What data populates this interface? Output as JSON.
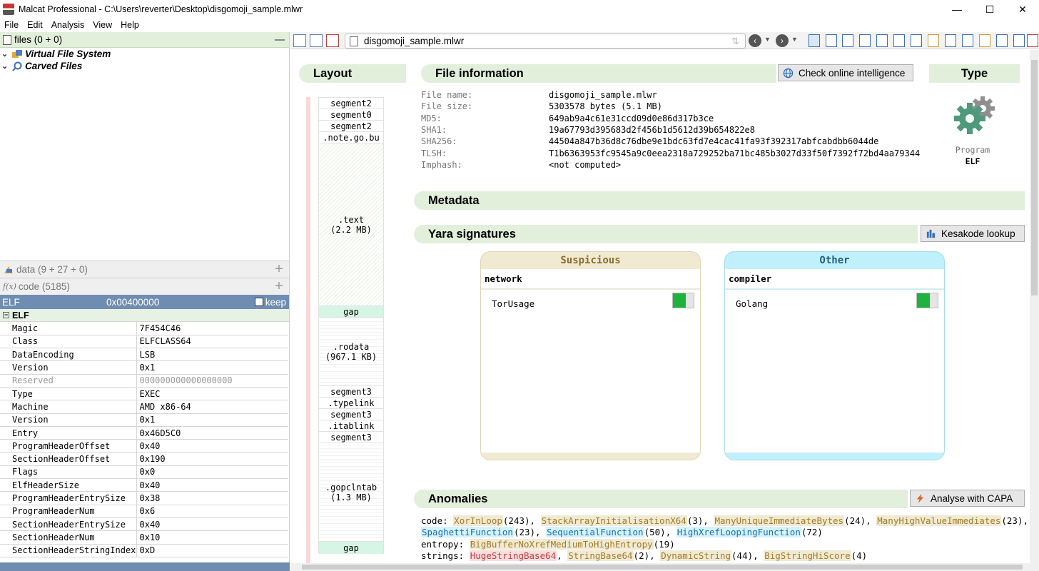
{
  "window": {
    "title": "Malcat Professional - C:\\Users\\reverter\\Desktop\\disgomoji_sample.mlwr",
    "min": "—",
    "max": "☐",
    "close": "✕"
  },
  "menu": [
    "File",
    "Edit",
    "Analysis",
    "View",
    "Help"
  ],
  "files_panel": {
    "header": "files (0 + 0)",
    "items": [
      "Virtual File System",
      "Carved Files"
    ]
  },
  "data_panel": {
    "header": "data (9 + 27 + 0)"
  },
  "code_panel": {
    "header": "code (5185)"
  },
  "structure": {
    "title": "ELF",
    "address": "0x00400000",
    "keep": "keep",
    "group": "ELF",
    "fields": [
      {
        "k": "Magic",
        "v": "7F454C46"
      },
      {
        "k": "Class",
        "v": "ELFCLASS64"
      },
      {
        "k": "DataEncoding",
        "v": "LSB"
      },
      {
        "k": "Version",
        "v": "0x1"
      },
      {
        "k": "Reserved",
        "v": "000000000000000000"
      },
      {
        "k": "Type",
        "v": "EXEC"
      },
      {
        "k": "Machine",
        "v": "AMD x86-64"
      },
      {
        "k": "Version",
        "v": "0x1"
      },
      {
        "k": "Entry",
        "v": "0x46D5C0"
      },
      {
        "k": "ProgramHeaderOffset",
        "v": "0x40"
      },
      {
        "k": "SectionHeaderOffset",
        "v": "0x190"
      },
      {
        "k": "Flags",
        "v": "0x0"
      },
      {
        "k": "ElfHeaderSize",
        "v": "0x40"
      },
      {
        "k": "ProgramHeaderEntrySize",
        "v": "0x38"
      },
      {
        "k": "ProgramHeaderNum",
        "v": "0x6"
      },
      {
        "k": "SectionHeaderEntrySize",
        "v": "0x40"
      },
      {
        "k": "SectionHeaderNum",
        "v": "0x10"
      },
      {
        "k": "SectionHeaderStringIndex",
        "v": "0xD"
      }
    ]
  },
  "toolbar": {
    "path": "disgomoji_sample.mlwr",
    "back": "‹",
    "forward": "›"
  },
  "layout": {
    "title": "Layout",
    "segments": [
      {
        "label": "segment2"
      },
      {
        "label": "segment0"
      },
      {
        "label": "segment2"
      },
      {
        "label": ".note.go.bu"
      },
      {
        "label": ".text",
        "size": "(2.2 MB)"
      },
      {
        "label": "gap"
      },
      {
        "label": ".rodata",
        "size": "(967.1 KB)"
      },
      {
        "label": "segment3"
      },
      {
        "label": ".typelink"
      },
      {
        "label": "segment3"
      },
      {
        "label": ".itablink"
      },
      {
        "label": "segment3"
      },
      {
        "label": ".gopclntab",
        "size": "(1.3 MB)"
      },
      {
        "label": "gap"
      }
    ]
  },
  "file_info": {
    "title": "File information",
    "button": "Check online intelligence",
    "rows": [
      {
        "k": "File name:",
        "v": "disgomoji_sample.mlwr"
      },
      {
        "k": "File size:",
        "v": "5303578 bytes (5.1 MB)"
      },
      {
        "k": "MD5:",
        "v": "649ab9a4c61e31ccd09d0e86d317b3ce"
      },
      {
        "k": "SHA1:",
        "v": "19a67793d395683d2f456b1d5612d39b654822e8"
      },
      {
        "k": "SHA256:",
        "v": "44504a847b36d8c76dbe9e1bdc63fd7e4cac41fa93f392317abfcabdbb6044de"
      },
      {
        "k": "TLSH:",
        "v": "T1b6363953fc9545a9c0eea2318a729252ba71bc485b3027d33f50f7392f72bd4aa79344"
      },
      {
        "k": "Imphash:",
        "v": "<not computed>"
      }
    ]
  },
  "type": {
    "title": "Type",
    "label": "Program",
    "value": "ELF",
    "icon": "gear-icon"
  },
  "metadata": {
    "title": "Metadata"
  },
  "yara": {
    "title": "Yara signatures",
    "button": "Kesakode lookup",
    "cards": [
      {
        "header": "Suspicious",
        "category": "network",
        "rule": "TorUsage",
        "color": "#f1ead2",
        "text_color": "#8a6c2a"
      },
      {
        "header": "Other",
        "category": "compiler",
        "rule": "Golang",
        "color": "#bff0fb",
        "text_color": "#22607c"
      }
    ]
  },
  "anomalies": {
    "title": "Anomalies",
    "button": "Analyse with CAPA",
    "code_label": "code:",
    "code": [
      {
        "t": "XorInLoop",
        "n": "(243)",
        "c": "sand"
      },
      {
        "t": "StackArrayInitialisationX64",
        "n": "(3)",
        "c": "sand"
      },
      {
        "t": "ManyUniqueImmediateBytes",
        "n": "(24)",
        "c": "sand"
      },
      {
        "t": "ManyHighValueImmediates",
        "n": "(23)",
        "c": "sand"
      },
      {
        "t": "SpaghettiFunction",
        "n": "(23)",
        "c": "blue"
      },
      {
        "t": "SequentialFunction",
        "n": "(50)",
        "c": "blue"
      },
      {
        "t": "HighXrefLoopingFunction",
        "n": "(72)",
        "c": "blue"
      }
    ],
    "entropy_label": "entropy:",
    "entropy": [
      {
        "t": "BigBufferNoXrefMediumToHighEntropy",
        "n": "(19)",
        "c": "sand"
      }
    ],
    "strings_label": "strings:",
    "strings": [
      {
        "t": "HugeStringBase64",
        "n": "",
        "c": "red"
      },
      {
        "t": "StringBase64",
        "n": "(2)",
        "c": "sand"
      },
      {
        "t": "DynamicString",
        "n": "(44)",
        "c": "sand"
      },
      {
        "t": "BigStringHiScore",
        "n": "(4)",
        "c": "sand"
      }
    ]
  }
}
